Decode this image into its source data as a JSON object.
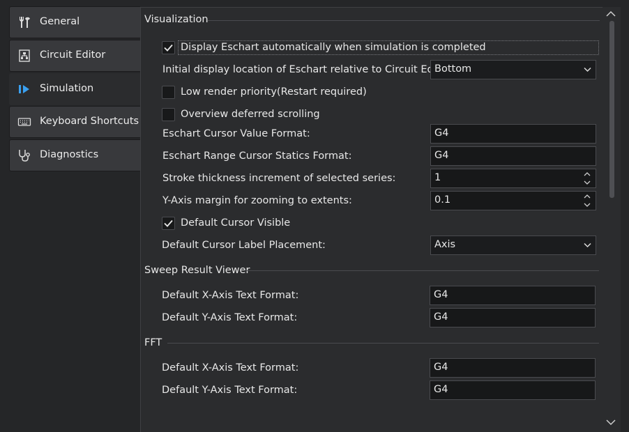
{
  "nav": {
    "items": [
      {
        "label": "General",
        "icon": "tools-icon"
      },
      {
        "label": "Circuit Editor",
        "icon": "circuit-icon"
      },
      {
        "label": "Simulation",
        "icon": "play-step-icon"
      },
      {
        "label": "Keyboard Shortcuts",
        "icon": "keyboard-icon"
      },
      {
        "label": "Diagnostics",
        "icon": "stethoscope-icon"
      }
    ],
    "active": "Simulation"
  },
  "colors": {
    "accent": "#3aa0f0",
    "background": "#2b2c2e",
    "field": "#171819"
  },
  "sections": {
    "visualization": {
      "title": "Visualization",
      "display_eschart": {
        "label": "Display Eschart automatically when simulation is completed",
        "checked": true
      },
      "initial_location": {
        "label": "Initial display location of Eschart relative to Circuit Editor:",
        "value": "Bottom"
      },
      "low_render": {
        "label": "Low render priority(Restart required)",
        "checked": false
      },
      "overview_scroll": {
        "label": "Overview deferred scrolling",
        "checked": false
      },
      "cursor_value_format": {
        "label": "Eschart Cursor Value Format:",
        "value": "G4"
      },
      "range_cursor_format": {
        "label": "Eschart Range Cursor Statics Format:",
        "value": "G4"
      },
      "stroke_increment": {
        "label": "Stroke thickness increment of selected series:",
        "value": "1"
      },
      "y_axis_margin": {
        "label": "Y-Axis margin for zooming to extents:",
        "value": "0.1"
      },
      "cursor_visible": {
        "label": "Default Cursor Visible",
        "checked": true
      },
      "cursor_label_placement": {
        "label": "Default Cursor Label Placement:",
        "value": "Axis"
      }
    },
    "sweep": {
      "title": "Sweep Result Viewer",
      "x_format": {
        "label": "Default X-Axis Text Format:",
        "value": "G4"
      },
      "y_format": {
        "label": "Default Y-Axis Text Format:",
        "value": "G4"
      }
    },
    "fft": {
      "title": "FFT",
      "x_format": {
        "label": "Default X-Axis Text Format:",
        "value": "G4"
      },
      "y_format": {
        "label": "Default Y-Axis Text Format:",
        "value": "G4"
      }
    }
  }
}
